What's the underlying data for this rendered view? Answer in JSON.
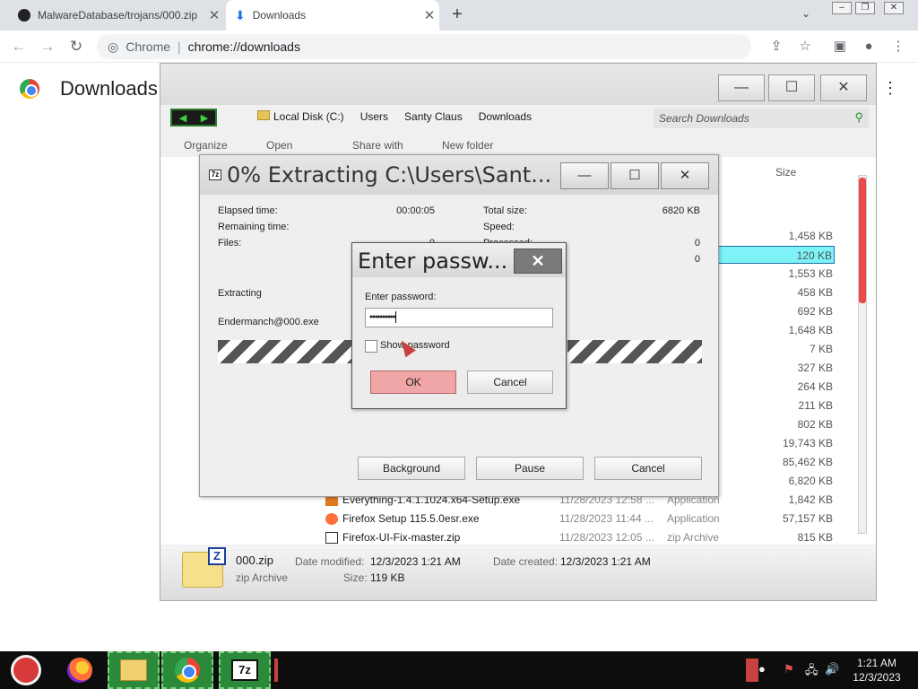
{
  "browser": {
    "tabs": [
      {
        "title": "MalwareDatabase/trojans/000.zip",
        "icon": "github-icon"
      },
      {
        "title": "Downloads",
        "icon": "download-icon"
      }
    ],
    "new_tab_symbol": "+",
    "omnibox": {
      "site_label": "Chrome",
      "url": "chrome://downloads"
    }
  },
  "downloads_page": {
    "title": "Downloads"
  },
  "explorer": {
    "breadcrumb": [
      "Local Disk (C:)",
      "Users",
      "Santy Claus",
      "Downloads"
    ],
    "search_placeholder": "Search Downloads",
    "commands": {
      "organize": "Organize",
      "open": "Open",
      "share": "Share with",
      "new_folder": "New folder"
    },
    "size_header": "Size",
    "sizes": [
      "1,458 KB",
      "120 KB",
      "1,553 KB",
      "458 KB",
      "692 KB",
      "1,648 KB",
      "7 KB",
      "327 KB",
      "264 KB",
      "211 KB",
      "802 KB",
      "19,743 KB",
      "85,462 KB",
      "6,820 KB",
      "1,842 KB",
      "57,157 KB",
      "815 KB"
    ],
    "visible_files": [
      {
        "name": "Everything-1.4.1.1024.x64-Setup.exe",
        "date": "11/28/2023 12:58 ...",
        "type": "Application"
      },
      {
        "name": "Firefox Setup 115.5.0esr.exe",
        "date": "11/28/2023 11:44 ...",
        "type": "Application"
      },
      {
        "name": "Firefox-UI-Fix-master.zip",
        "date": "11/28/2023 12:05 ...",
        "type": "zip Archive"
      }
    ],
    "details": {
      "name": "000.zip",
      "type": "zip Archive",
      "date_modified_label": "Date modified:",
      "date_modified": "12/3/2023 1:21 AM",
      "date_created_label": "Date created:",
      "date_created": "12/3/2023 1:21 AM",
      "size_label": "Size:",
      "size": "119 KB"
    }
  },
  "extract_window": {
    "title": "0% Extracting C:\\Users\\Sant...",
    "elapsed_label": "Elapsed time:",
    "elapsed_value": "00:00:05",
    "remaining_label": "Remaining time:",
    "files_label": "Files:",
    "files_value": "0",
    "total_size_label": "Total size:",
    "total_size_value": "6820 KB",
    "speed_label": "Speed:",
    "processed_label": "Processed:",
    "processed_value": "0",
    "extra_value": "0",
    "status": "Extracting",
    "current_file": "Endermanch@000.exe",
    "buttons": {
      "background": "Background",
      "pause": "Pause",
      "cancel": "Cancel"
    }
  },
  "password_dialog": {
    "title": "Enter passw...",
    "prompt": "Enter password:",
    "masked_value": "••••••••••",
    "show_password_label": "Show password",
    "show_password_checked": false,
    "ok_label": "OK",
    "cancel_label": "Cancel"
  },
  "taskbar": {
    "apps": [
      "santa-start-icon",
      "firefox-icon",
      "file-explorer-icon",
      "chrome-icon",
      "7zip-icon"
    ],
    "seven_zip_label": "7z",
    "time": "1:21 AM",
    "date": "12/3/2023"
  },
  "colors": {
    "selected_row": "#7df3f8",
    "ok_button": "#f0a6a6",
    "scroll_thumb": "#e84a4a",
    "taskbar_green": "#2a8a3a"
  }
}
